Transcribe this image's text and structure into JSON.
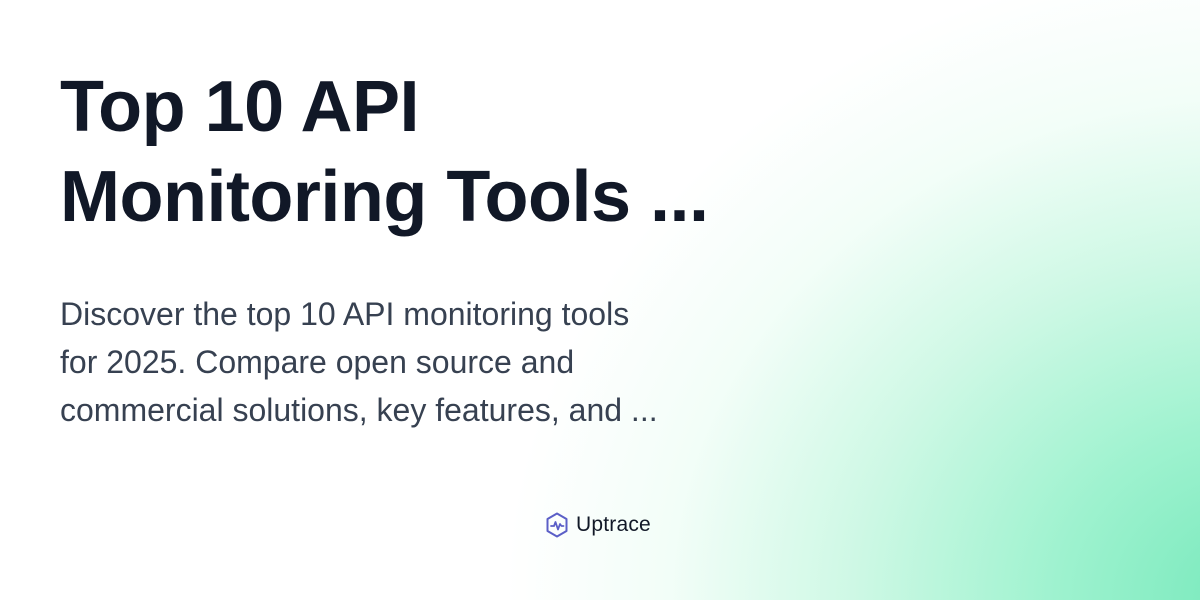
{
  "title": {
    "line1": "Top 10 API",
    "line2": "Monitoring Tools ..."
  },
  "description": {
    "line1": "Discover the top 10 API monitoring tools",
    "line2": "for 2025. Compare open source and",
    "line3": "commercial solutions, key features, and ..."
  },
  "brand": {
    "name": "Uptrace",
    "icon": "uptrace-logo-icon"
  },
  "colors": {
    "background": "#ffffff",
    "gradient_accent": "#6ee7b7",
    "title_text": "#111827",
    "description_text": "#374151",
    "logo_stroke": "#5b5fc7"
  }
}
